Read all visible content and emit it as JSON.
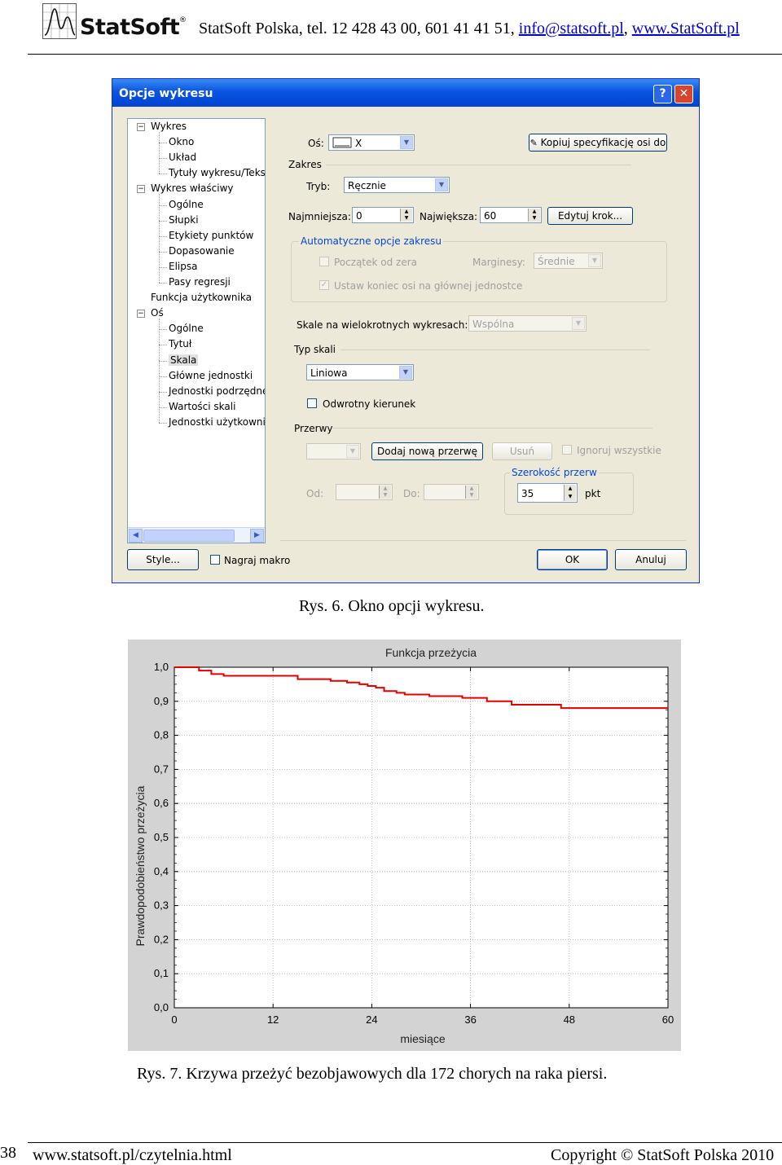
{
  "header": {
    "logo_text": "StatSoft",
    "logo_reg": "®",
    "contact_prefix": "StatSoft Polska, tel. 12 428 43 00, 601 41 41 51, ",
    "email": "info@statsoft.pl",
    "separator": ", ",
    "website": "www.StatSoft.pl"
  },
  "dialog": {
    "title": "Opcje wykresu",
    "help_glyph": "?",
    "close_glyph": "✕",
    "tree": [
      {
        "label": "Wykres",
        "level": 0,
        "expander": "−"
      },
      {
        "label": "Okno",
        "level": 1
      },
      {
        "label": "Układ",
        "level": 1
      },
      {
        "label": "Tytuły wykresu/Teks",
        "level": 1
      },
      {
        "label": "Wykres właściwy",
        "level": 0,
        "expander": "−"
      },
      {
        "label": "Ogólne",
        "level": 1
      },
      {
        "label": "Słupki",
        "level": 1
      },
      {
        "label": "Etykiety punktów",
        "level": 1
      },
      {
        "label": "Dopasowanie",
        "level": 1
      },
      {
        "label": "Elipsa",
        "level": 1
      },
      {
        "label": "Pasy regresji",
        "level": 1
      },
      {
        "label": "Funkcja użytkownika",
        "level": 0
      },
      {
        "label": "Oś",
        "level": 0,
        "expander": "−"
      },
      {
        "label": "Ogólne",
        "level": 1
      },
      {
        "label": "Tytuł",
        "level": 1
      },
      {
        "label": "Skala",
        "level": 1,
        "selected": true
      },
      {
        "label": "Główne jednostki",
        "level": 1
      },
      {
        "label": "Jednostki podrzędne",
        "level": 1
      },
      {
        "label": "Wartości skali",
        "level": 1
      },
      {
        "label": "Jednostki użytkownil",
        "level": 1
      }
    ],
    "axis_label": "Oś:",
    "axis_value": "X",
    "copy_axis_button": "Kopiuj specyfikację osi do",
    "range_label": "Zakres",
    "mode_label": "Tryb:",
    "mode_value": "Ręcznie",
    "min_label": "Najmniejsza:",
    "min_value": "0",
    "max_label": "Największa:",
    "max_value": "60",
    "edit_step_button": "Edytuj krok...",
    "auto_group_title": "Automatyczne opcje zakresu",
    "start_zero_label": "Początek od zera",
    "margins_label": "Marginesy:",
    "margins_value": "Średnie",
    "set_end_label": "Ustaw koniec osi na głównej jednostce",
    "set_end_checked": "✓",
    "multi_scale_label": "Skale na wielokrotnych wykresach:",
    "multi_scale_value": "Wspólna",
    "scale_type_label": "Typ skali",
    "scale_type_value": "Liniowa",
    "reverse_label": "Odwrotny kierunek",
    "breaks_label": "Przerwy",
    "add_break_button": "Dodaj nową przerwę",
    "delete_button": "Usuń",
    "ignore_all_label": "Ignoruj wszystkie",
    "from_label": "Od:",
    "to_label": "Do:",
    "width_group_title": "Szerokość przerw",
    "width_value": "35",
    "width_unit": "pkt",
    "style_button": "Style...",
    "record_macro_label": "Nagraj makro",
    "ok_button": "OK",
    "cancel_button": "Anuluj"
  },
  "caption1": "Rys. 6. Okno opcji wykresu.",
  "chart_data": {
    "type": "line",
    "title": "Funkcja przeżycia",
    "xlabel": "miesiące",
    "ylabel": "Prawdopodobieństwo przeżycia",
    "xlim": [
      0,
      60
    ],
    "ylim": [
      0,
      1
    ],
    "x_ticks": [
      "0",
      "12",
      "24",
      "36",
      "48",
      "60"
    ],
    "y_ticks": [
      "0,0",
      "0,1",
      "0,2",
      "0,3",
      "0,4",
      "0,5",
      "0,6",
      "0,7",
      "0,8",
      "0,9",
      "1,0"
    ],
    "grid": true,
    "series_color": "#e00000",
    "step_points": [
      [
        3,
        1.0
      ],
      [
        3,
        0.99
      ],
      [
        4.5,
        0.99
      ],
      [
        4.5,
        0.98
      ],
      [
        6,
        0.98
      ],
      [
        6,
        0.975
      ],
      [
        15,
        0.975
      ],
      [
        15,
        0.965
      ],
      [
        19,
        0.965
      ],
      [
        19,
        0.96
      ],
      [
        21,
        0.96
      ],
      [
        21,
        0.955
      ],
      [
        22.5,
        0.955
      ],
      [
        22.5,
        0.95
      ],
      [
        23.5,
        0.95
      ],
      [
        23.5,
        0.945
      ],
      [
        24.5,
        0.945
      ],
      [
        24.5,
        0.94
      ],
      [
        25.5,
        0.94
      ],
      [
        25.5,
        0.93
      ],
      [
        27,
        0.93
      ],
      [
        27,
        0.925
      ],
      [
        28,
        0.925
      ],
      [
        28,
        0.92
      ],
      [
        31,
        0.92
      ],
      [
        31,
        0.915
      ],
      [
        35,
        0.915
      ],
      [
        35,
        0.91
      ],
      [
        38,
        0.91
      ],
      [
        38,
        0.9
      ],
      [
        41,
        0.9
      ],
      [
        41,
        0.89
      ],
      [
        47,
        0.89
      ],
      [
        47,
        0.88
      ],
      [
        60,
        0.88
      ]
    ]
  },
  "caption2": "Rys. 7. Krzywa przeżyć bezobjawowych dla 172 chorych na raka piersi.",
  "footer": {
    "page_number": "38",
    "link": "www.statsoft.pl/czytelnia.html",
    "copyright": "Copyright © StatSoft Polska 2010"
  }
}
